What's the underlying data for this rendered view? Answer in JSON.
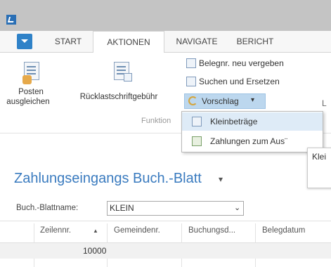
{
  "tabs": [
    "START",
    "AKTIONEN",
    "NAVIGATE",
    "BERICHT"
  ],
  "ribbon": {
    "posten_ausgleichen": [
      "Posten",
      "ausgleichen"
    ],
    "ruecklastschrift": "Rücklastschriftgebühr",
    "belegnr_neu": "Belegnr. neu vergeben",
    "suchen_ersetzen": "Suchen und Ersetzen",
    "vorschlag": "Vorschlag",
    "vorschlag_arrow": "▾",
    "group_label": "Funktion",
    "cutoff_label": "L"
  },
  "dropdown_items": [
    "Kleinbeträge",
    "Zahlungen zum Aus¨"
  ],
  "tooltip_text": "Klei",
  "page_title": "Zahlungseingangs Buch.-Blatt",
  "page_title_arrow": "▾",
  "batch_field": {
    "label": "Buch.-Blattname:",
    "value": "KLEIN",
    "arrow": "⌄"
  },
  "grid": {
    "columns": [
      "Zeilennr.",
      "Gemeindenr.",
      "Buchungsd...",
      "Belegdatum"
    ],
    "sort_indicator": "▲",
    "rows": [
      [
        "10000"
      ]
    ]
  }
}
